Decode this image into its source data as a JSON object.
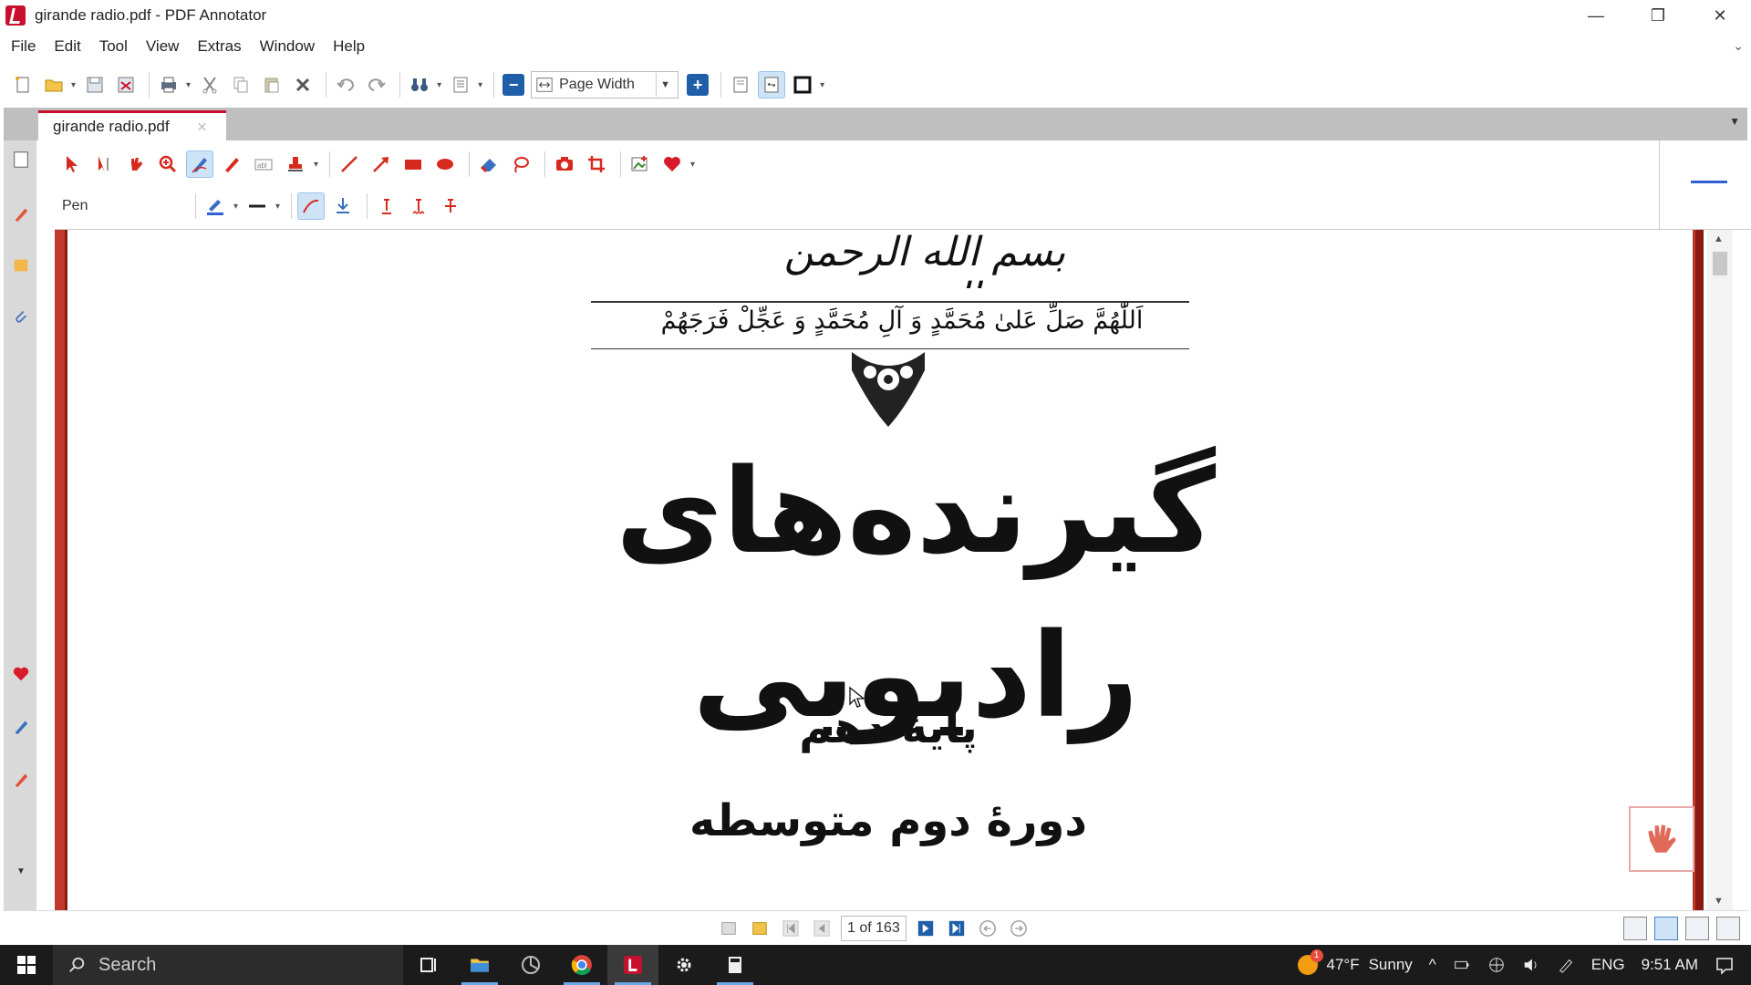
{
  "window": {
    "title": "girande radio.pdf - PDF Annotator",
    "controls": {
      "minimize": "—",
      "restore": "❐",
      "close": "✕"
    }
  },
  "menu": [
    "File",
    "Edit",
    "Tool",
    "View",
    "Extras",
    "Window",
    "Help"
  ],
  "toolbar": {
    "zoom_value": "Page Width"
  },
  "tabs": [
    {
      "label": "girande radio.pdf"
    }
  ],
  "annotation": {
    "tool_label": "Pen"
  },
  "document": {
    "bismillah": "بسم الله الرحمن الرحیم",
    "salawat": "اَللّٰهُمَّ صَلِّ عَلىٰ مُحَمَّدٍ وَ آلِ مُحَمَّدٍ وَ عَجِّلْ فَرَجَهُمْ",
    "title": "گیرنده‌های رادیویی",
    "grade": "پایۀ دهم",
    "period": "دورۀ دوم متوسطه"
  },
  "navigation": {
    "page_indicator": "1 of 163"
  },
  "taskbar": {
    "search_label": "Search",
    "weather_temp": "47°F",
    "weather_text": "Sunny",
    "language": "ENG",
    "time": "9:51 AM"
  },
  "colors": {
    "accent": "#c8102e",
    "page_border": "#c0392b",
    "taskbar": "#1b1b1b"
  }
}
